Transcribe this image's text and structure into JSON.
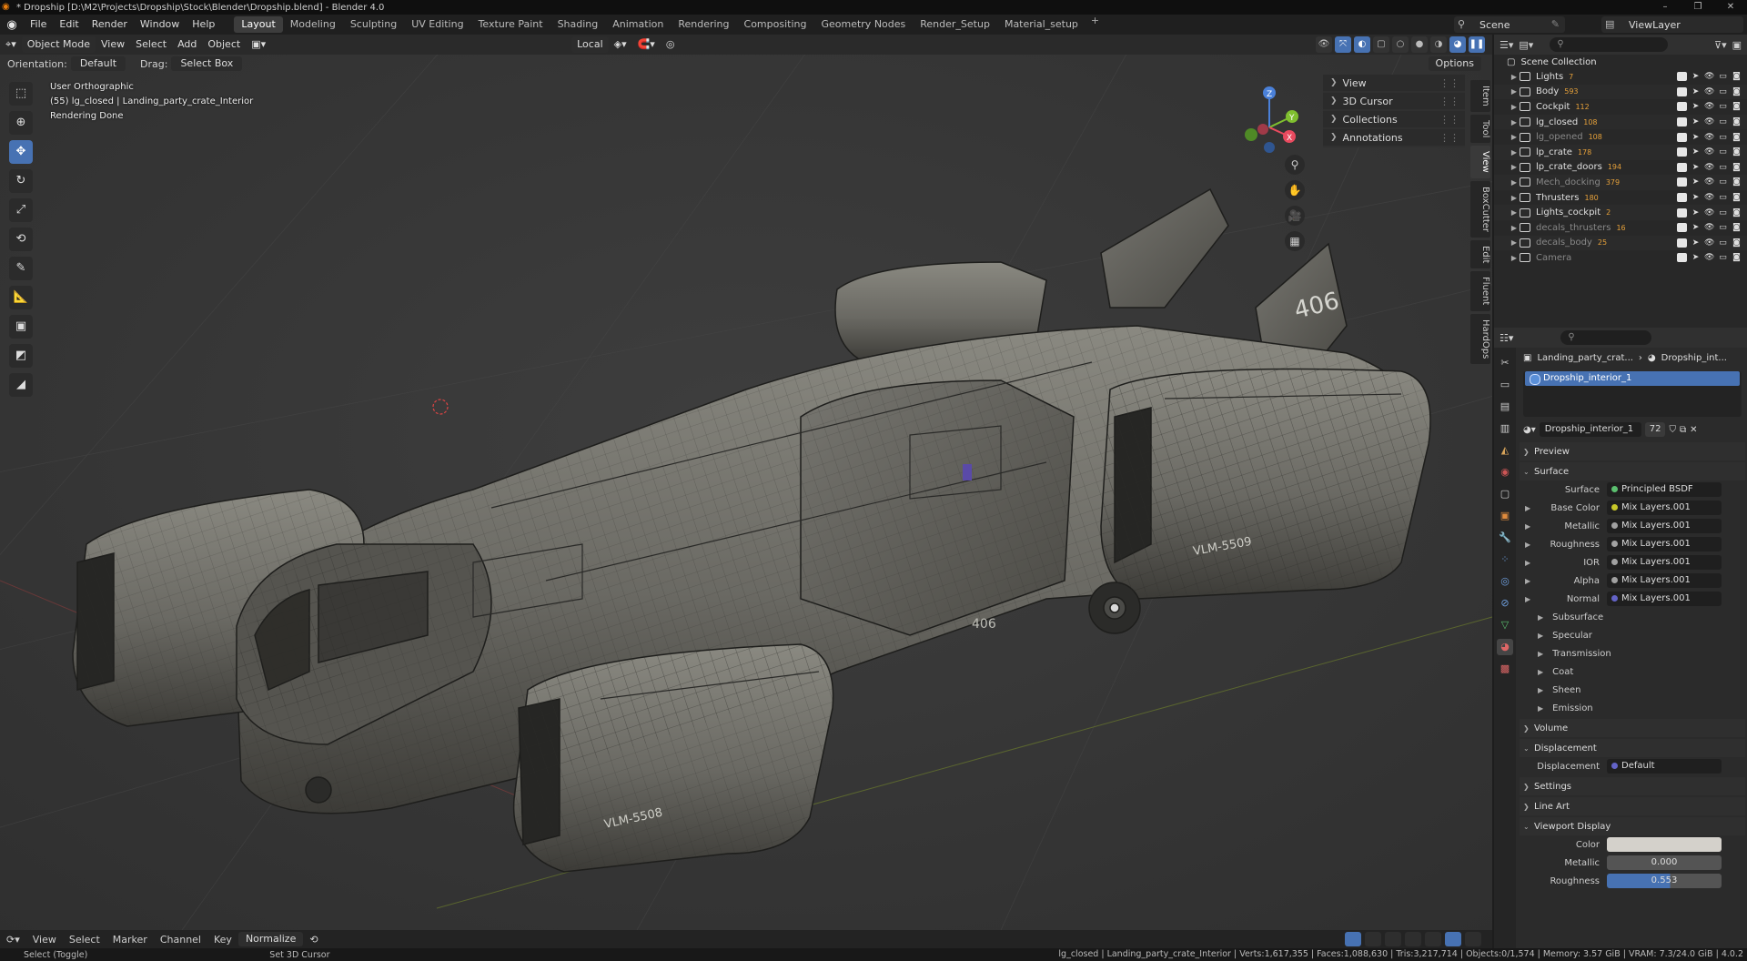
{
  "window": {
    "title": "* Dropship [D:\\M2\\Projects\\Dropship\\Stock\\Blender\\Dropship.blend] - Blender 4.0",
    "controls": [
      "–",
      "❐",
      "✕"
    ]
  },
  "menu": [
    "File",
    "Edit",
    "Render",
    "Window",
    "Help"
  ],
  "workspaces": [
    "Layout",
    "Modeling",
    "Sculpting",
    "UV Editing",
    "Texture Paint",
    "Shading",
    "Animation",
    "Rendering",
    "Compositing",
    "Geometry Nodes",
    "Render_Setup",
    "Material_setup"
  ],
  "active_workspace": "Layout",
  "scene": "Scene",
  "view_layer": "ViewLayer",
  "viewport": {
    "mode": "Object Mode",
    "menus": [
      "View",
      "Select",
      "Add",
      "Object"
    ],
    "transform_orientation": "Local",
    "orientation_label": "Orientation:",
    "orientation_value": "Default",
    "drag_label": "Drag:",
    "drag_value": "Select Box",
    "options": "Options",
    "hud": [
      "User Orthographic",
      "(55) lg_closed | Landing_party_crate_Interior",
      "Rendering Done"
    ],
    "tools": [
      "select-box",
      "cursor",
      "move",
      "rotate",
      "scale",
      "transform",
      "annotate",
      "measure",
      "add-cube",
      "shrink-fatten",
      "shear"
    ],
    "ship_markings": [
      "VLM-5508",
      "VLM-5509",
      "406",
      "406"
    ]
  },
  "npanel": {
    "items": [
      "View",
      "3D Cursor",
      "Collections",
      "Annotations"
    ],
    "tabs": [
      "Item",
      "Tool",
      "View",
      "BoxCutter",
      "Edit",
      "Fluent",
      "HardOps"
    ]
  },
  "gizmo": {
    "x": "X",
    "y": "Y",
    "z": "Z"
  },
  "timeline": {
    "menus": [
      "View",
      "Select",
      "Marker",
      "Channel",
      "Key"
    ],
    "normalize": "Normalize"
  },
  "status": {
    "select": "Select (Toggle)",
    "cursor": "Set 3D Cursor",
    "stats": "lg_closed | Landing_party_crate_Interior | Verts:1,617,355 | Faces:1,088,630 | Tris:3,217,714 | Objects:0/1,574 | Memory: 3.57 GiB | VRAM: 7.3/24.0 GiB | 4.0.2"
  },
  "outliner": {
    "root": "Scene Collection",
    "items": [
      {
        "name": "Lights",
        "badge": "7",
        "dim": false
      },
      {
        "name": "Body",
        "badge": "593",
        "dim": false
      },
      {
        "name": "Cockpit",
        "badge": "112",
        "dim": false
      },
      {
        "name": "lg_closed",
        "badge": "108",
        "dim": false
      },
      {
        "name": "lg_opened",
        "badge": "108",
        "dim": true
      },
      {
        "name": "lp_crate",
        "badge": "178",
        "dim": false
      },
      {
        "name": "lp_crate_doors",
        "badge": "194",
        "dim": false
      },
      {
        "name": "Mech_docking",
        "badge": "379",
        "dim": true
      },
      {
        "name": "Thrusters",
        "badge": "180",
        "dim": false
      },
      {
        "name": "Lights_cockpit",
        "badge": "2",
        "dim": false
      },
      {
        "name": "decals_thrusters",
        "badge": "16",
        "dim": true
      },
      {
        "name": "decals_body",
        "badge": "25",
        "dim": true
      },
      {
        "name": "Camera",
        "badge": "",
        "dim": true
      }
    ]
  },
  "properties": {
    "breadcrumb_obj": "Landing_party_crat...",
    "breadcrumb_mat": "Dropship_int...",
    "slot": "Dropship_interior_1",
    "material": "Dropship_interior_1",
    "users": "72",
    "sections": {
      "preview": "Preview",
      "surface": "Surface",
      "volume": "Volume",
      "displacement": "Displacement",
      "settings": "Settings",
      "lineart": "Line Art",
      "viewport_display": "Viewport Display"
    },
    "surface_label": "Surface",
    "surface_value": "Principled BSDF",
    "inputs": [
      {
        "label": "Base Color",
        "value": "Mix Layers.001",
        "dot": "#c7c729"
      },
      {
        "label": "Metallic",
        "value": "Mix Layers.001",
        "dot": "#a1a1a1"
      },
      {
        "label": "Roughness",
        "value": "Mix Layers.001",
        "dot": "#a1a1a1"
      },
      {
        "label": "IOR",
        "value": "Mix Layers.001",
        "dot": "#a1a1a1"
      },
      {
        "label": "Alpha",
        "value": "Mix Layers.001",
        "dot": "#a1a1a1"
      },
      {
        "label": "Normal",
        "value": "Mix Layers.001",
        "dot": "#6363c7"
      }
    ],
    "subpanels": [
      "Subsurface",
      "Specular",
      "Transmission",
      "Coat",
      "Sheen",
      "Emission"
    ],
    "displacement_label": "Displacement",
    "displacement_value": "Default",
    "vd_color": "Color",
    "vd_metallic": "Metallic",
    "vd_metallic_val": "0.000",
    "vd_roughness": "Roughness",
    "vd_roughness_val": "0.553"
  }
}
